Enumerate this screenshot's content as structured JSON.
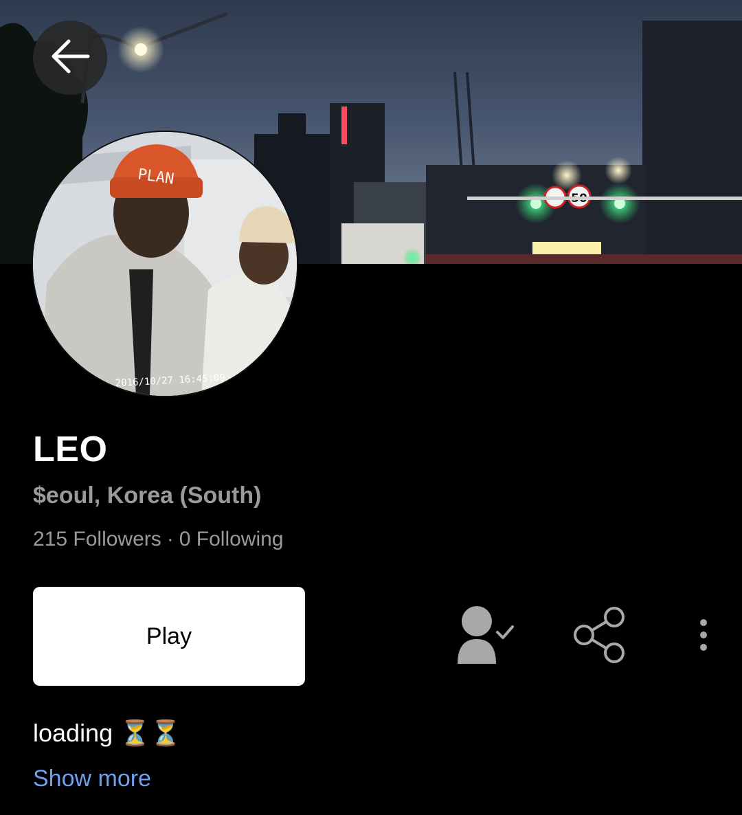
{
  "header": {
    "back_icon": "arrow-left-icon"
  },
  "avatar": {
    "timestamp": "2016/10/27 16:45:09",
    "hat_text": "PLAN"
  },
  "cover": {
    "speed_sign": "50"
  },
  "profile": {
    "name": "LEO",
    "location": "$eoul, Korea (South)",
    "followers": "215 Followers",
    "separator": "·",
    "following": "0 Following"
  },
  "actions": {
    "play_label": "Play",
    "following_icon": "person-check-icon",
    "share_icon": "share-icon",
    "more_icon": "more-vertical-icon"
  },
  "bio": {
    "text": "loading ⏳⏳",
    "show_more": "Show more"
  },
  "colors": {
    "background": "#000000",
    "muted_text": "#9a9a9a",
    "link": "#6fa0f0",
    "button_bg": "#ffffff"
  }
}
